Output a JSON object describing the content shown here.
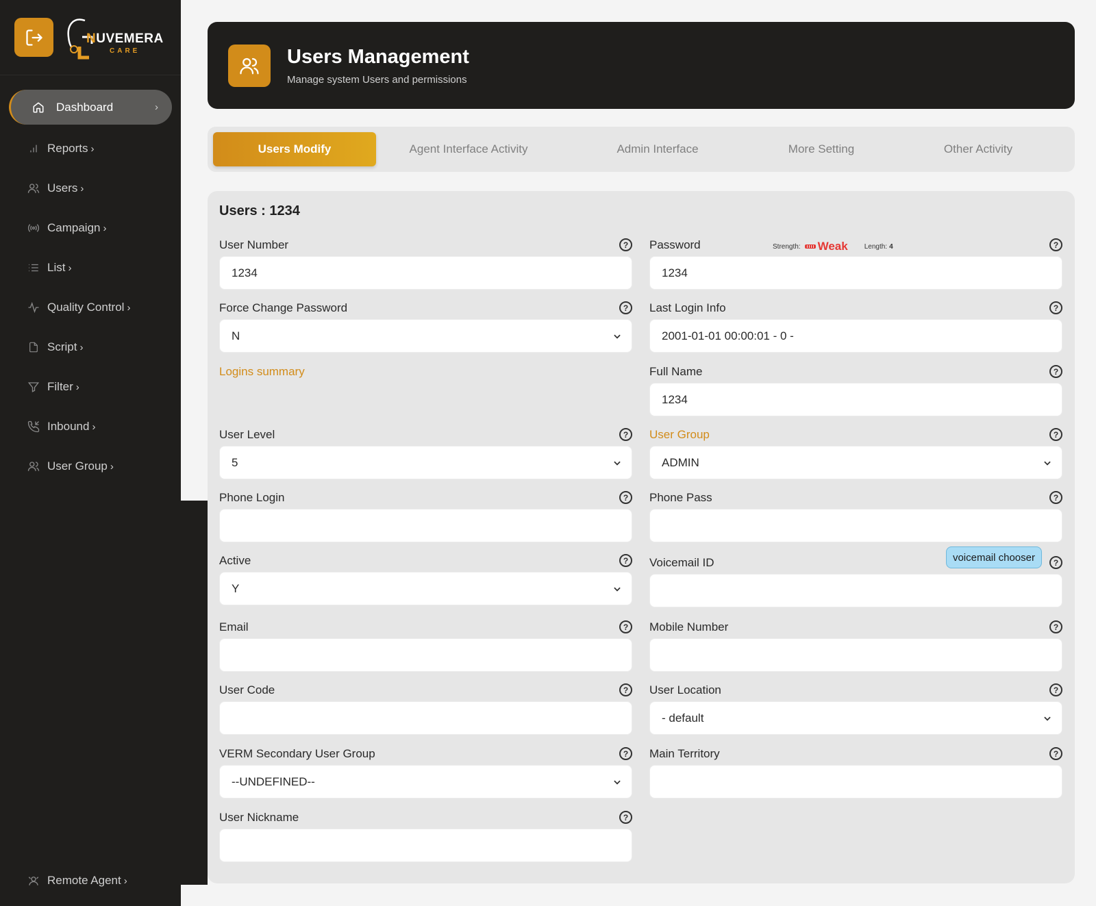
{
  "brand": {
    "name_first": "N",
    "name_rest": "UVEMERA",
    "sub": "CARE"
  },
  "sidebar": {
    "items": [
      {
        "label": "Dashboard",
        "chev": "›"
      },
      {
        "label": "Reports",
        "chev": "›"
      },
      {
        "label": "Users",
        "chev": "›"
      },
      {
        "label": "Campaign",
        "chev": "›"
      },
      {
        "label": "List",
        "chev": "›"
      },
      {
        "label": "Quality Control",
        "chev": "›"
      },
      {
        "label": "Script",
        "chev": "›"
      },
      {
        "label": "Filter",
        "chev": "›"
      },
      {
        "label": "Inbound",
        "chev": "›"
      },
      {
        "label": "User Group",
        "chev": "›"
      }
    ],
    "remote": {
      "label": "Remote Agent",
      "chev": "›"
    }
  },
  "header": {
    "title": "Users Management",
    "subtitle": "Manage system Users and permissions"
  },
  "tabs": [
    "Users Modify",
    "Agent Interface Activity",
    "Admin Interface",
    "More Setting",
    "Other Activity"
  ],
  "form": {
    "title": "Users : 1234",
    "user_number": {
      "label": "User Number",
      "value": "1234"
    },
    "password": {
      "label": "Password",
      "value": "1234",
      "strength_label": "Strength:",
      "strength_value": "Weak",
      "length_label": "Length:",
      "length_value": "4"
    },
    "force_change_password": {
      "label": "Force Change Password",
      "value": "N"
    },
    "last_login_info": {
      "label": "Last Login Info",
      "value": "2001-01-01 00:00:01 - 0 -"
    },
    "logins_summary": "Logins summary",
    "full_name": {
      "label": "Full Name",
      "value": "1234"
    },
    "user_level": {
      "label": "User Level",
      "value": "5"
    },
    "user_group": {
      "label": "User Group",
      "value": "ADMIN"
    },
    "phone_login": {
      "label": "Phone Login",
      "value": ""
    },
    "phone_pass": {
      "label": "Phone Pass",
      "value": ""
    },
    "active": {
      "label": "Active",
      "value": "Y"
    },
    "voicemail_id": {
      "label": "Voicemail ID",
      "value": "",
      "button": "voicemail chooser"
    },
    "email": {
      "label": "Email",
      "value": ""
    },
    "mobile_number": {
      "label": "Mobile Number",
      "value": ""
    },
    "user_code": {
      "label": "User Code",
      "value": ""
    },
    "user_location": {
      "label": "User Location",
      "value": "- default"
    },
    "verm_secondary_user_group": {
      "label": "VERM Secondary User Group",
      "value": "--UNDEFINED--"
    },
    "main_territory": {
      "label": "Main Territory",
      "value": ""
    },
    "user_nickname": {
      "label": "User Nickname",
      "value": ""
    },
    "help_glyph": "?"
  },
  "colors": {
    "accent": "#d28c1a",
    "sidebar_bg": "#1f1e1c",
    "panel_bg": "#e6e6e6",
    "danger": "#e53935",
    "info_btn": "#a9dcf5"
  },
  "icons": [
    "logout-icon",
    "users-icon",
    "home-icon",
    "bar-chart-icon",
    "user-icon",
    "broadcast-icon",
    "list-icon",
    "activity-icon",
    "file-icon",
    "filter-icon",
    "phone-incoming-icon",
    "remote-agent-icon",
    "help-icon",
    "chevron-down-icon"
  ]
}
